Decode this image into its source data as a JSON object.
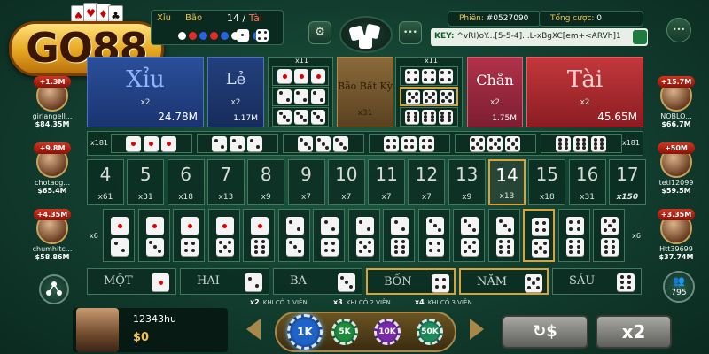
{
  "logo": {
    "text": "GO88",
    "cards": [
      "♠",
      "♥",
      "♦",
      "♣"
    ]
  },
  "history": {
    "xiu_label": "Xỉu",
    "bao_label": "Bão",
    "count": "14 /",
    "tai_label": "Tài",
    "dots": [
      "#ffffff",
      "#e02b2b",
      "#2b62e0",
      "#e02b2b",
      "#2b62e0",
      "#ffffff",
      "#e02b2b",
      "#2b62e0"
    ]
  },
  "session": {
    "label": "Phiên:",
    "value": "#0527090"
  },
  "total_bet": {
    "label": "Tổng cược:",
    "value": "0"
  },
  "key": {
    "label": "KEY:",
    "value": "^vRI)oY...[5-5-4]...L-xBgXC[em+<ARVh]1"
  },
  "top_icons": {
    "rules": "⚙",
    "menu": "•••",
    "chat": "•••"
  },
  "bets": {
    "xiu": {
      "name": "Xỉu",
      "mult": "x2",
      "amount": "24.78M"
    },
    "le": {
      "name": "Lẻ",
      "mult": "x2",
      "amount": "1.17M"
    },
    "any_triple": {
      "name": "Bão Bất Kỳ",
      "mult": "x31"
    },
    "chan": {
      "name": "Chẵn",
      "mult": "x2",
      "amount": "1.75M"
    },
    "tai": {
      "name": "Tài",
      "mult": "x2",
      "amount": "45.65M"
    },
    "triples_left_mult": "x11",
    "triples_right_mult": "x11",
    "specific_triple_mult": "x181"
  },
  "sums": [
    {
      "n": "4",
      "m": "x61"
    },
    {
      "n": "5",
      "m": "x31"
    },
    {
      "n": "6",
      "m": "x18"
    },
    {
      "n": "7",
      "m": "x13"
    },
    {
      "n": "8",
      "m": "x9"
    },
    {
      "n": "9",
      "m": "x7"
    },
    {
      "n": "10",
      "m": "x7"
    },
    {
      "n": "11",
      "m": "x7"
    },
    {
      "n": "12",
      "m": "x7"
    },
    {
      "n": "13",
      "m": "x9"
    },
    {
      "n": "14",
      "m": "x13"
    },
    {
      "n": "15",
      "m": "x18"
    },
    {
      "n": "16",
      "m": "x31"
    },
    {
      "n": "17",
      "m": "x150"
    }
  ],
  "pair_mult": "x6",
  "singles": [
    {
      "label": "MỘT",
      "face": 1
    },
    {
      "label": "HAI",
      "face": 2
    },
    {
      "label": "BA",
      "face": 3
    },
    {
      "label": "BỐN",
      "face": 4
    },
    {
      "label": "NĂM",
      "face": 5
    },
    {
      "label": "SÁU",
      "face": 6
    }
  ],
  "rules": [
    {
      "mult": "x2",
      "text": "KHI CÓ 1 VIÊN"
    },
    {
      "mult": "x3",
      "text": "KHI CÓ 2 VIÊN"
    },
    {
      "mult": "x4",
      "text": "KHI CÓ 3 VIÊN"
    }
  ],
  "players_left": [
    {
      "win": "+1.3M",
      "name": "girlangell...",
      "balance": "$84.35M"
    },
    {
      "win": "+9.8M",
      "name": "chotaog...",
      "balance": "$65.4M"
    },
    {
      "win": "+4.35M",
      "name": "chumhitc...",
      "balance": "$58.86M"
    }
  ],
  "players_right": [
    {
      "win": "+15.7M",
      "name": "NOBLO...",
      "balance": "$66.7M"
    },
    {
      "win": "+50M",
      "name": "tetl12099",
      "balance": "$59.5M"
    },
    {
      "win": "+3.35M",
      "name": "Htt39699",
      "balance": "$37.74M"
    }
  ],
  "online_count": "795",
  "user": {
    "name": "12343hu",
    "balance": "$0"
  },
  "chips": [
    "1K",
    "5K",
    "10K",
    "50K"
  ],
  "buttons": {
    "rebet": "↻$",
    "double": "x2"
  }
}
